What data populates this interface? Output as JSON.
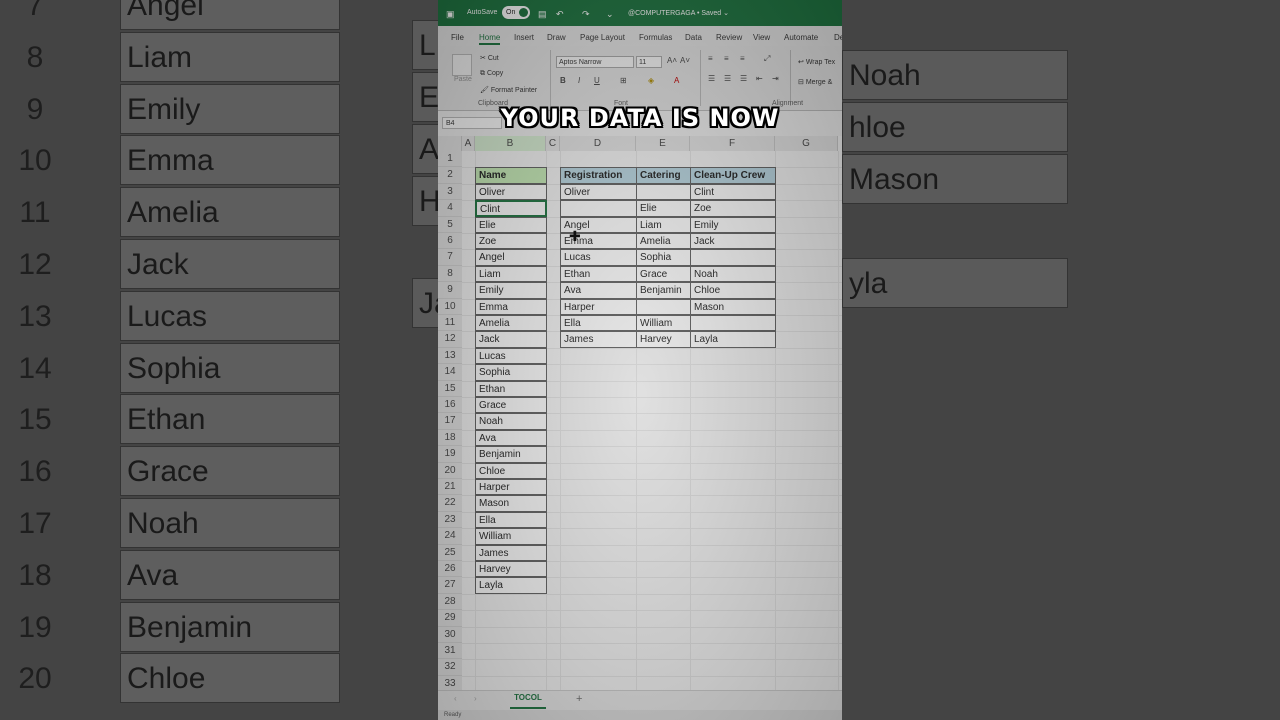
{
  "background_left": {
    "rows": [
      {
        "num": "7",
        "name": "Angel"
      },
      {
        "num": "8",
        "name": "Liam"
      },
      {
        "num": "9",
        "name": "Emily"
      },
      {
        "num": "10",
        "name": "Emma"
      },
      {
        "num": "11",
        "name": "Amelia"
      },
      {
        "num": "12",
        "name": "Jack"
      },
      {
        "num": "13",
        "name": "Lucas"
      },
      {
        "num": "14",
        "name": "Sophia"
      },
      {
        "num": "15",
        "name": "Ethan"
      },
      {
        "num": "16",
        "name": "Grace"
      },
      {
        "num": "17",
        "name": "Noah"
      },
      {
        "num": "18",
        "name": "Ava"
      },
      {
        "num": "19",
        "name": "Benjamin"
      },
      {
        "num": "20",
        "name": "Chloe"
      }
    ]
  },
  "background_right": {
    "fragments": [
      "Noah",
      "hloe",
      "Mason",
      "yla",
      "L",
      "E",
      "A",
      "H",
      "Ja"
    ]
  },
  "titlebar": {
    "autosave_label": "AutoSave",
    "autosave_state": "On",
    "doc_title": "@COMPUTERGAGA • Saved ⌄"
  },
  "ribbon_tabs": [
    "File",
    "Home",
    "Insert",
    "Draw",
    "Page Layout",
    "Formulas",
    "Data",
    "Review",
    "View",
    "Automate",
    "De"
  ],
  "ribbon": {
    "paste": "Paste",
    "cut": "Cut",
    "copy": "Copy",
    "format_painter": "Format Painter",
    "clipboard_group": "Clipboard",
    "font_name": "Aptos Narrow",
    "font_size": "11",
    "font_group": "Font",
    "bold": "B",
    "italic": "I",
    "underline": "U",
    "wrap_text": "Wrap Tex",
    "merge": "Merge &",
    "alignment_group": "Alignment"
  },
  "formula_bar": {
    "name_box": "B4"
  },
  "columns": [
    "A",
    "B",
    "C",
    "D",
    "E",
    "F",
    "G"
  ],
  "row_numbers": [
    "1",
    "2",
    "3",
    "4",
    "5",
    "6",
    "7",
    "8",
    "9",
    "10",
    "11",
    "12",
    "13",
    "14",
    "15",
    "16",
    "17",
    "18",
    "19",
    "20",
    "21",
    "22",
    "23",
    "24",
    "25",
    "26",
    "27",
    "28",
    "29",
    "30",
    "31",
    "32",
    "33"
  ],
  "name_list": {
    "header": "Name",
    "values": [
      "Oliver",
      "Clint",
      "Elie",
      "Zoe",
      "Angel",
      "Liam",
      "Emily",
      "Emma",
      "Amelia",
      "Jack",
      "Lucas",
      "Sophia",
      "Ethan",
      "Grace",
      "Noah",
      "Ava",
      "Benjamin",
      "Chloe",
      "Harper",
      "Mason",
      "Ella",
      "William",
      "James",
      "Harvey",
      "Layla"
    ]
  },
  "crew_table": {
    "headers": [
      "Registration",
      "Catering",
      "Clean-Up Crew"
    ],
    "rows": [
      [
        "Oliver",
        "",
        "Clint"
      ],
      [
        "",
        "Elie",
        "Zoe"
      ],
      [
        "Angel",
        "Liam",
        "Emily"
      ],
      [
        "Emma",
        "Amelia",
        "Jack"
      ],
      [
        "Lucas",
        "Sophia",
        ""
      ],
      [
        "Ethan",
        "Grace",
        "Noah"
      ],
      [
        "Ava",
        "Benjamin",
        "Chloe"
      ],
      [
        "Harper",
        "",
        "Mason"
      ],
      [
        "Ella",
        "William",
        ""
      ],
      [
        "James",
        "Harvey",
        "Layla"
      ]
    ]
  },
  "sheet_tab": "TOCOL",
  "status": "Ready",
  "caption": "YOUR DATA IS NOW"
}
